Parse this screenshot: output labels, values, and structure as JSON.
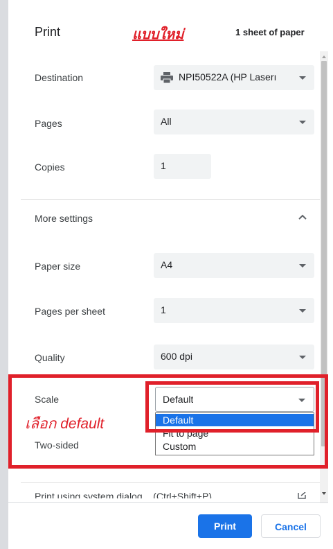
{
  "header": {
    "title": "Print",
    "annotation_new": "แบบใหม่",
    "sheet_count": "1 sheet of paper"
  },
  "settings": {
    "destination": {
      "label": "Destination",
      "value": "NPI50522A (HP Laserı"
    },
    "pages": {
      "label": "Pages",
      "value": "All"
    },
    "copies": {
      "label": "Copies",
      "value": "1"
    },
    "more_settings": {
      "label": "More settings"
    },
    "paper_size": {
      "label": "Paper size",
      "value": "A4"
    },
    "pages_per_sheet": {
      "label": "Pages per sheet",
      "value": "1"
    },
    "quality": {
      "label": "Quality",
      "value": "600 dpi"
    },
    "scale": {
      "label": "Scale",
      "value": "Default",
      "options": [
        "Default",
        "Fit to page",
        "Custom"
      ],
      "highlighted_option": "Default"
    },
    "two_sided": {
      "label": "Two-sided"
    }
  },
  "annotation_choose": "เลือก default",
  "system_dialog": {
    "label": "Print using system dialog... (Ctrl+Shift+P)"
  },
  "footer": {
    "print_label": "Print",
    "cancel_label": "Cancel"
  },
  "colors": {
    "accent": "#1a73e8",
    "highlight": "#1a73e8",
    "annotation": "#e0202a"
  },
  "icons": {
    "printer": "printer-icon",
    "external": "open-external-icon",
    "chevron_up": "chevron-up-icon"
  }
}
